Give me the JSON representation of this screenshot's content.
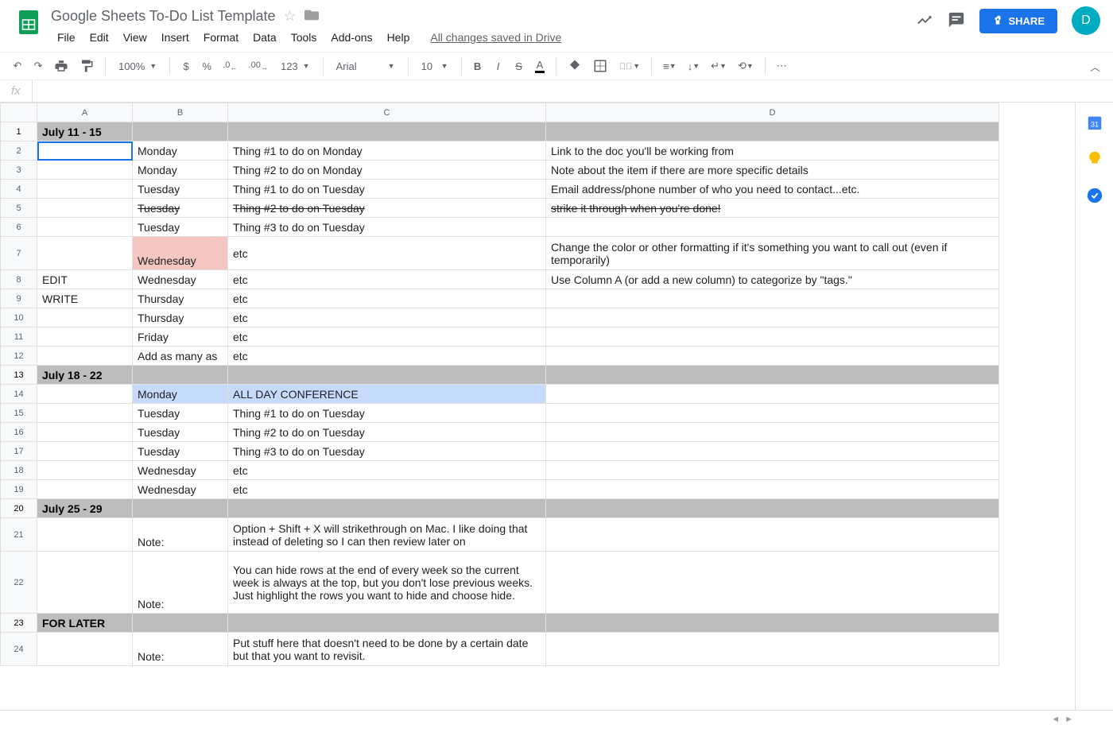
{
  "doc": {
    "title": "Google Sheets To-Do List Template",
    "saved": "All changes saved in Drive"
  },
  "menu": {
    "file": "File",
    "edit": "Edit",
    "view": "View",
    "insert": "Insert",
    "format": "Format",
    "data": "Data",
    "tools": "Tools",
    "addons": "Add-ons",
    "help": "Help"
  },
  "share": {
    "label": "SHARE"
  },
  "avatar": {
    "letter": "D"
  },
  "toolbar": {
    "zoom": "100%",
    "currency": "$",
    "percent": "%",
    "dec0": ".0",
    "dec00": ".00",
    "num": "123",
    "font": "Arial",
    "size": "10"
  },
  "fx": {
    "label": "fx"
  },
  "cols": {
    "a": "A",
    "b": "B",
    "c": "C",
    "d": "D"
  },
  "rows": [
    {
      "n": "1",
      "a": "July 11 - 15",
      "b": "",
      "c": "",
      "d": "",
      "cls": "hdr-row"
    },
    {
      "n": "2",
      "a": "",
      "b": "Monday",
      "c": "Thing #1 to do on Monday",
      "d": "Link to the doc you'll be working from",
      "sel": true
    },
    {
      "n": "3",
      "a": "",
      "b": "Monday",
      "c": "Thing #2 to do on Monday",
      "d": "Note about the item if there are more specific details"
    },
    {
      "n": "4",
      "a": "",
      "b": "Tuesday",
      "c": "Thing #1 to do on Tuesday",
      "d": "Email address/phone number of who you need to contact...etc."
    },
    {
      "n": "5",
      "a": "",
      "b": "Tuesday",
      "c": "Thing #2 to do on Tuesday",
      "d": "strike it through when you're done!",
      "strike": true
    },
    {
      "n": "6",
      "a": "",
      "b": "Tuesday",
      "c": "Thing #3 to do on Tuesday",
      "d": ""
    },
    {
      "n": "7",
      "a": "",
      "b": "Wednesday",
      "c": "etc",
      "d": "Change the color or other formatting if it's something you want to call out (even if temporarily)",
      "bpink": true,
      "tall": true,
      "dwrap": true
    },
    {
      "n": "8",
      "a": "EDIT",
      "b": "Wednesday",
      "c": "etc",
      "d": "Use Column A (or add a new column) to categorize by \"tags.\""
    },
    {
      "n": "9",
      "a": "WRITE",
      "b": "Thursday",
      "c": "etc",
      "d": ""
    },
    {
      "n": "10",
      "a": "",
      "b": "Thursday",
      "c": "etc",
      "d": ""
    },
    {
      "n": "11",
      "a": "",
      "b": "Friday",
      "c": "etc",
      "d": ""
    },
    {
      "n": "12",
      "a": "",
      "b": "Add as many as",
      "c": "etc",
      "d": ""
    },
    {
      "n": "13",
      "a": "July 18 - 22",
      "b": "",
      "c": "",
      "d": "",
      "cls": "hdr-row"
    },
    {
      "n": "14",
      "a": "",
      "b": "Monday",
      "c": "ALL DAY CONFERENCE",
      "d": "",
      "blue": true
    },
    {
      "n": "15",
      "a": "",
      "b": "Tuesday",
      "c": "Thing #1 to do on Tuesday",
      "d": ""
    },
    {
      "n": "16",
      "a": "",
      "b": "Tuesday",
      "c": "Thing #2 to do on Tuesday",
      "d": ""
    },
    {
      "n": "17",
      "a": "",
      "b": "Tuesday",
      "c": "Thing #3 to do on Tuesday",
      "d": ""
    },
    {
      "n": "18",
      "a": "",
      "b": "Wednesday",
      "c": "etc",
      "d": ""
    },
    {
      "n": "19",
      "a": "",
      "b": "Wednesday",
      "c": "etc",
      "d": ""
    },
    {
      "n": "20",
      "a": "July 25 - 29",
      "b": "",
      "c": "",
      "d": "",
      "cls": "hdr-row"
    },
    {
      "n": "21",
      "a": "",
      "b": "Note:",
      "c": "Option + Shift + X will strikethrough on Mac. I like doing that instead of deleting so I can then review later on",
      "d": "",
      "tall": true,
      "cwrap": true
    },
    {
      "n": "22",
      "a": "",
      "b": "Note:",
      "c": "You can hide rows at the end of every week so the current week is always at the top, but you don't lose previous weeks. Just highlight the rows you want to hide and choose hide.",
      "d": "",
      "tall4": true,
      "cwrap": true
    },
    {
      "n": "23",
      "a": "FOR LATER",
      "b": "",
      "c": "",
      "d": "",
      "cls": "hdr-row"
    },
    {
      "n": "24",
      "a": "",
      "b": "Note:",
      "c": "Put stuff here that doesn't need to be done by a certain date but that you want to revisit.",
      "d": "",
      "tall": true,
      "cwrap": true
    }
  ]
}
